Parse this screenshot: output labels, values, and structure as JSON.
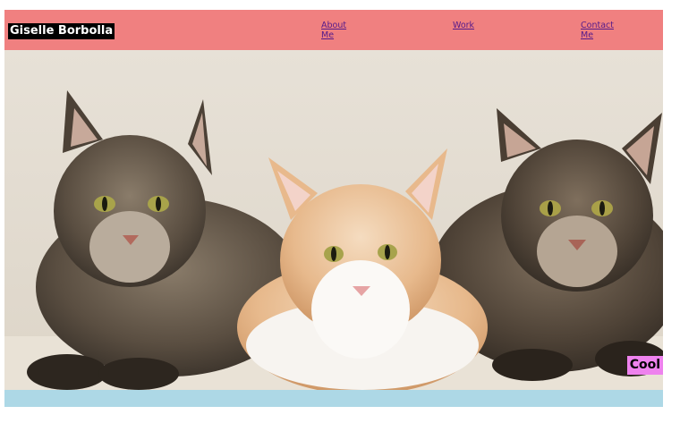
{
  "header": {
    "brand": "Giselle Borbolla",
    "nav": [
      {
        "label": "About Me"
      },
      {
        "label": "Work"
      },
      {
        "label": "Contact Me"
      }
    ]
  },
  "hero": {
    "image": "three-maine-coon-cats",
    "badge": "Cool"
  },
  "colors": {
    "header_bg": "#f08080",
    "brand_bg": "#000000",
    "badge_bg": "#ee82ee",
    "footer_bg": "#add8e6"
  }
}
